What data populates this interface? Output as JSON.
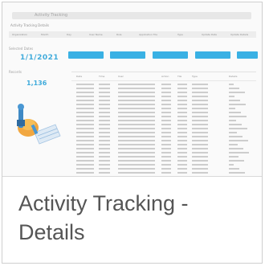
{
  "tile": {
    "title_line1": "Activity Tracking -",
    "title_line2": "Details"
  },
  "thumbnail": {
    "address_text": "Activity Tracking",
    "breadcrumb": "Activity Tracking  Details",
    "column_headers": [
      "Organization",
      "Month",
      "Day",
      "User Name",
      "Role",
      "Application Tile",
      "Type",
      "Update Date",
      "Update Details"
    ],
    "section_label": "Selected Dates",
    "date_value": "1/1/2021",
    "buttons": [
      "",
      "",
      "",
      "",
      ""
    ],
    "total_label": "Records",
    "total_value": "1,136",
    "table_headers": [
      "Date",
      "Time",
      "User",
      "Action",
      "Tile",
      "Type",
      "Details"
    ],
    "row_count": 24,
    "colors": {
      "accent": "#29abe2",
      "value_text": "#2fa4d8",
      "caption_text": "#555555",
      "border": "#cfcfcf"
    },
    "icon": "activity-tracking-illustration"
  }
}
